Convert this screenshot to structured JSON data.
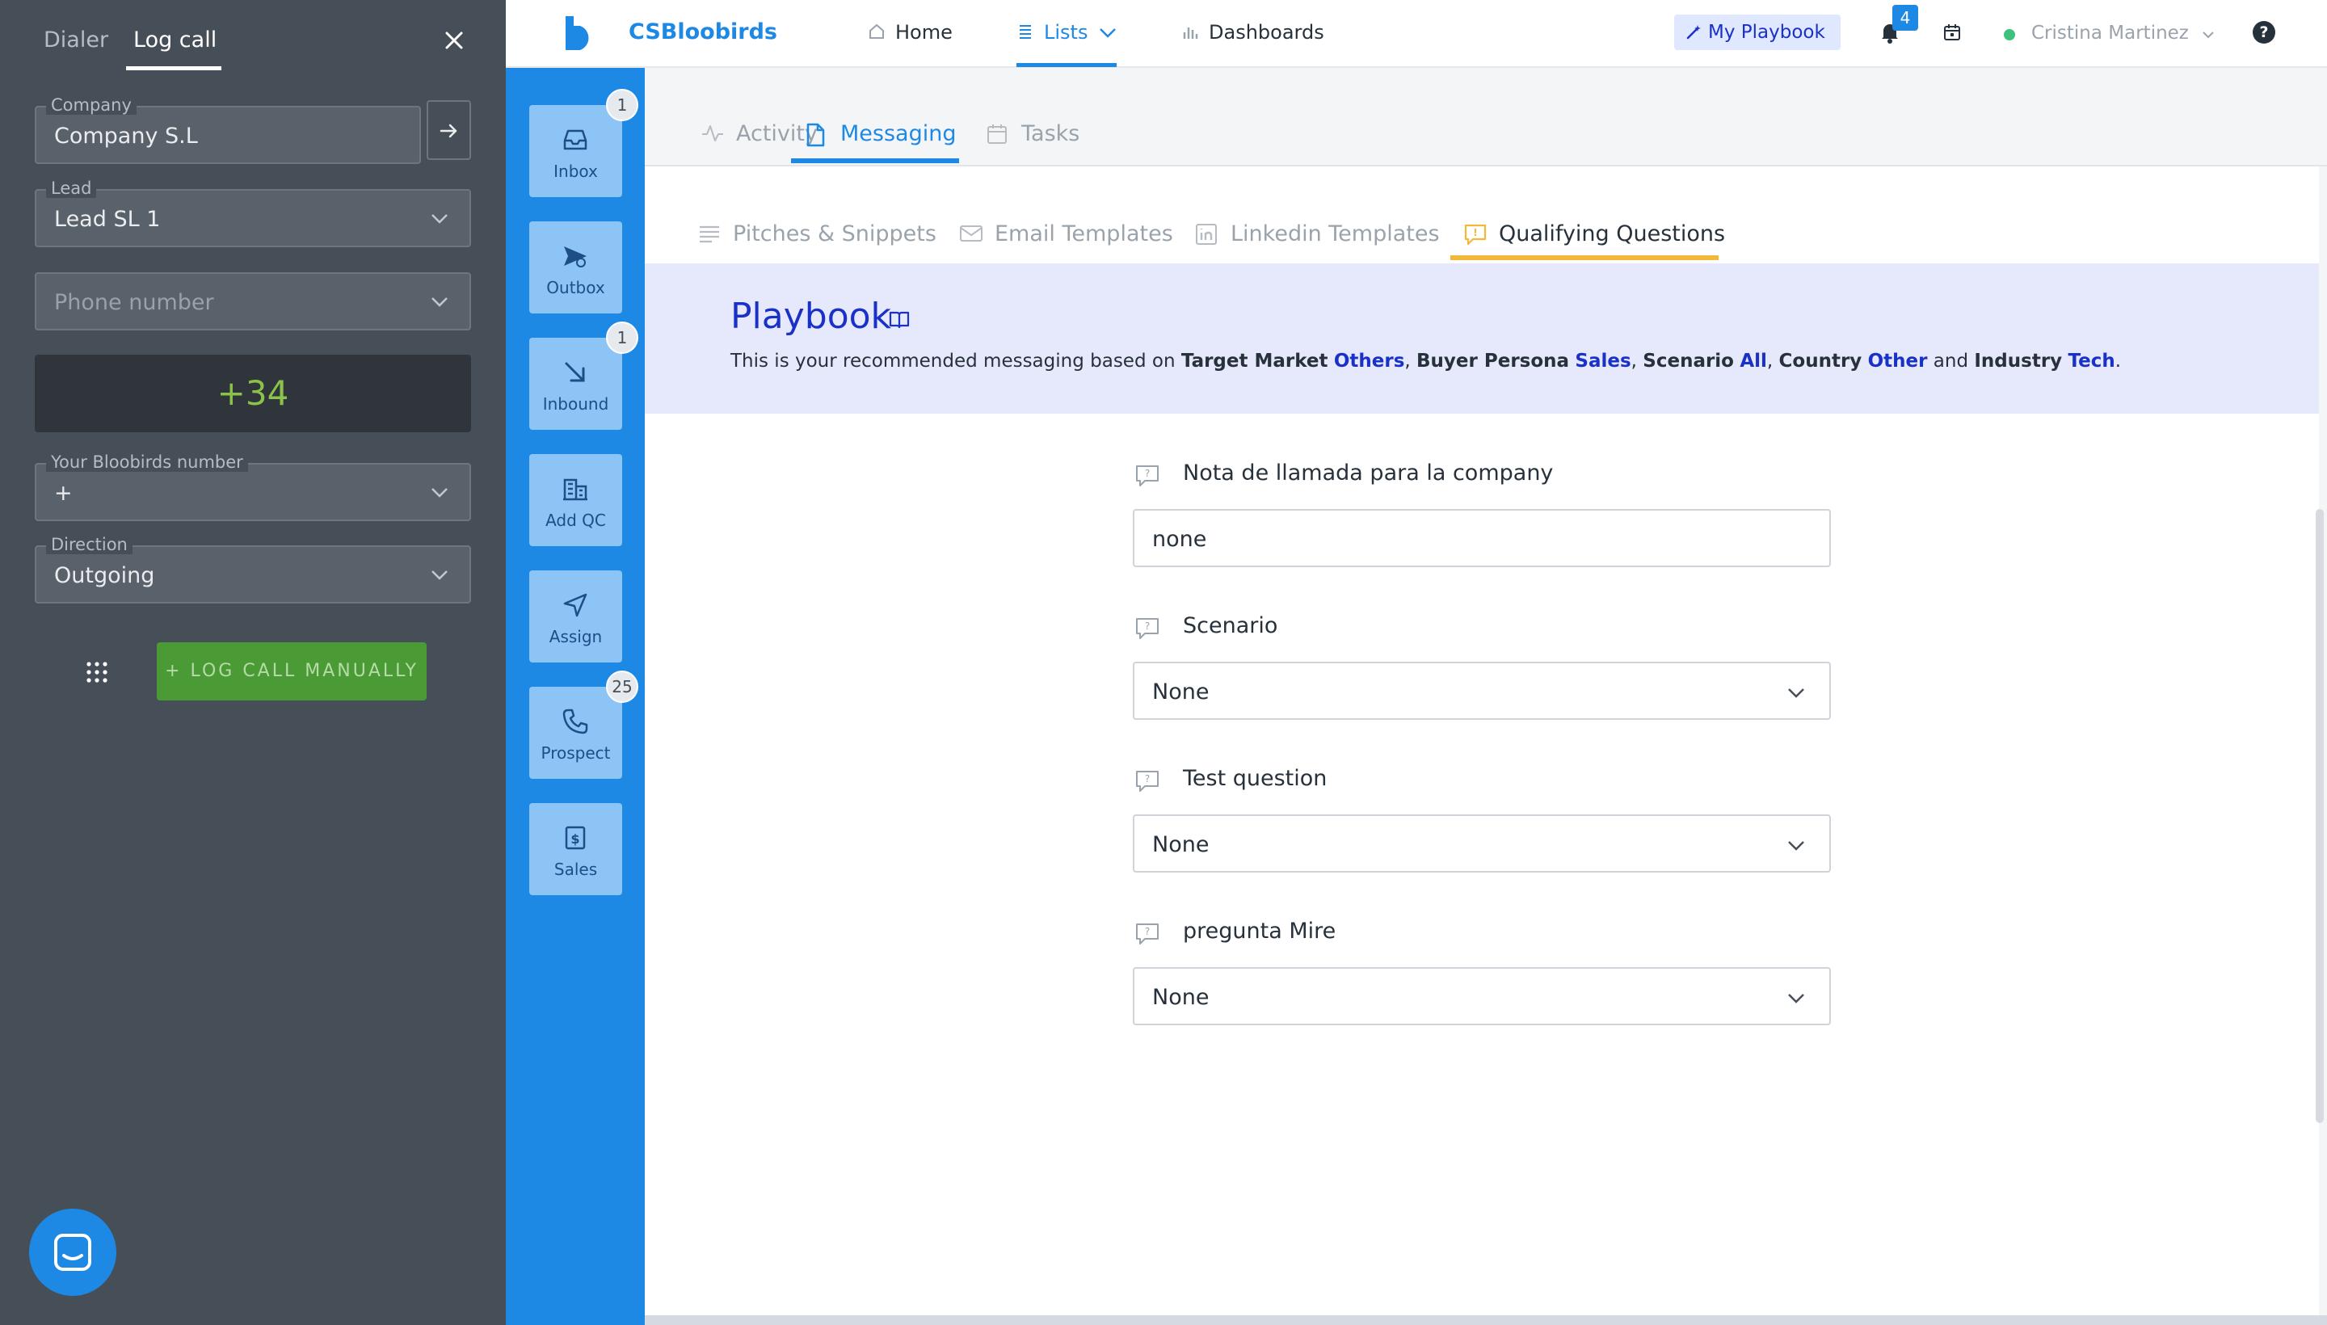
{
  "dialer": {
    "tabs": {
      "dialer": "Dialer",
      "log_call": "Log call"
    },
    "company": {
      "label": "Company",
      "value": "Company S.L"
    },
    "lead": {
      "label": "Lead",
      "value": "Lead SL 1"
    },
    "phone": {
      "placeholder": "Phone number"
    },
    "country_code": "+34",
    "bloobirds_number": {
      "label": "Your Bloobirds number",
      "value": "+"
    },
    "direction": {
      "label": "Direction",
      "value": "Outgoing"
    },
    "log_manually_button": "+ LOG CALL MANUALLY"
  },
  "sidebar": {
    "items": [
      {
        "label": "Inbox",
        "badge": "1",
        "icon": "inbox-icon"
      },
      {
        "label": "Outbox",
        "badge": "",
        "icon": "outbox-icon"
      },
      {
        "label": "Inbound",
        "badge": "1",
        "icon": "inbound-arrow-icon"
      },
      {
        "label": "Add QC",
        "badge": "",
        "icon": "building-icon"
      },
      {
        "label": "Assign",
        "badge": "",
        "icon": "send-icon"
      },
      {
        "label": "Prospect",
        "badge": "25",
        "icon": "phone-icon"
      },
      {
        "label": "Sales",
        "badge": "",
        "icon": "dollar-icon"
      }
    ]
  },
  "topbar": {
    "brand": "CSBloobirds",
    "nav": {
      "home": "Home",
      "lists": "Lists",
      "dashboards": "Dashboards"
    },
    "my_playbook": "My Playbook",
    "notification_count": "4",
    "user_name": "Cristina Martinez",
    "help": "?"
  },
  "main_tabs": {
    "activity": "Activity",
    "messaging": "Messaging",
    "tasks": "Tasks"
  },
  "sub_tabs": {
    "pitches": "Pitches & Snippets",
    "email": "Email Templates",
    "linkedin": "Linkedin Templates",
    "qualifying": "Qualifying Questions"
  },
  "playbook": {
    "title": "Playbook",
    "desc": {
      "intro": "This is your recommended messaging based on ",
      "k1": "Target Market",
      "v1": "Others",
      "k2": "Buyer Persona",
      "v2": "Sales",
      "k3": "Scenario",
      "v3": "All",
      "k4": "Country",
      "v4": "Other",
      "and": " and ",
      "k5": "Industry",
      "v5": "Tech",
      "sep": ", ",
      "end": "."
    }
  },
  "questions": [
    {
      "label": "Nota de llamada para la company",
      "value": "none",
      "type": "text"
    },
    {
      "label": "Scenario",
      "value": "None",
      "type": "select"
    },
    {
      "label": "Test question",
      "value": "None",
      "type": "select"
    },
    {
      "label": "pregunta Mire",
      "value": "None",
      "type": "select"
    }
  ],
  "colors": {
    "primary": "#1e88e5",
    "playbook_blue": "#1a31c8",
    "dialer_bg": "#464f57",
    "log_button_green": "#4a9a36",
    "qualifying_accent": "#f2b939"
  }
}
